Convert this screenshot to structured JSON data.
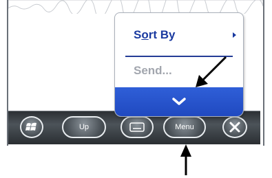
{
  "popup_menu": {
    "sort_by": {
      "label": "Sort By",
      "access_key": "o"
    },
    "send": {
      "label": "Send...",
      "enabled": false
    },
    "scroll_button_icon": "chevron-down-icon"
  },
  "taskbar": {
    "start_icon": "windows-logo-icon",
    "up_label": "Up",
    "keyboard_icon": "keyboard-icon",
    "menu_label": "Menu",
    "close_icon": "close-icon"
  },
  "annotations": {
    "arrow_to_menu_button": "arrow-up-icon",
    "arrow_to_scroll_button": "arrow-diagonal-icon"
  },
  "colors": {
    "menu_text": "#1a3aa0",
    "disabled_text": "#a2a6ae",
    "scroll_button": "#2f5fd8",
    "taskbar": "#3a4045"
  }
}
